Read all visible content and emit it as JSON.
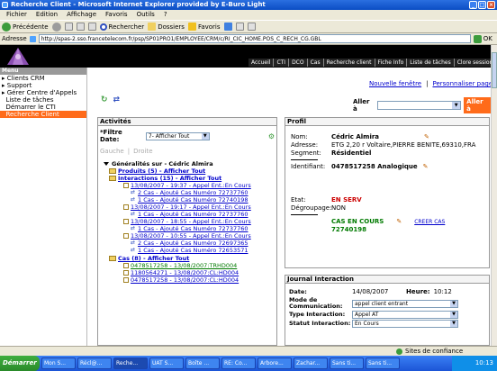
{
  "window": {
    "title": "Recherche Client - Microsoft Internet Explorer provided by E-Buro Light"
  },
  "menu": [
    "Fichier",
    "Edition",
    "Affichage",
    "Favoris",
    "Outils",
    "?"
  ],
  "toolbar": {
    "back": "Précédente",
    "search": "Rechercher",
    "folders": "Dossiers",
    "favorites": "Favoris"
  },
  "address": {
    "label": "Adresse",
    "url": "http://spas-2.sso.francetelecom.fr/psp/SP01PRO1/EMPLOYEE/CRM/c/RI_CIC_HOME.POS_C_RECH_CG.GBL",
    "go": "OK"
  },
  "nav": [
    "Accueil",
    "CTI",
    "DCO",
    "Cas",
    "Recherche client",
    "Fiche Info",
    "Liste de tâches",
    "Clore session"
  ],
  "sidebar": {
    "title": "Menu",
    "items": [
      "Clients CRM",
      "Support",
      "Gérer Centre d'Appels",
      "Liste de tâches",
      "Démarrer le CTI",
      "Recherche Client"
    ]
  },
  "main": {
    "links": [
      "Nouvelle fenêtre",
      "Personnaliser page"
    ],
    "goto_label": "Aller à",
    "goto_btn": "Aller à"
  },
  "activites": {
    "title": "Activités",
    "filter_label": "*Filtre Date:",
    "filter_value": "7- Afficher Tout",
    "nav_prev": "Gauche",
    "nav_next": "Droite",
    "root": "Généralités sur - Cédric Almira",
    "produits": "Produits (5) - Afficher Tout",
    "interactions": "Interactions (15) - Afficher Tout",
    "items": [
      {
        "type": "cal",
        "text": "13/08/2007 - 19:37 - Appel Ent.:En Cours"
      },
      {
        "type": "arr",
        "text": "2 Cas - Ajouté Cas Numéro 72737760"
      },
      {
        "type": "arr",
        "text": "1 Cas - Ajouté Cas Numéro 72740198"
      },
      {
        "type": "cal",
        "text": "13/08/2007 - 19:17 - Appel Ent.:En Cours"
      },
      {
        "type": "arr",
        "text": "1 Cas - Ajouté Cas Numéro 72737760"
      },
      {
        "type": "cal",
        "text": "13/08/2007 - 18:55 - Appel Ent.:En Cours"
      },
      {
        "type": "arr",
        "text": "1 Cas - Ajouté Cas Numéro 72737760"
      },
      {
        "type": "cal",
        "text": "13/08/2007 - 10:55 - Appel Ent.:En Cours"
      },
      {
        "type": "arr",
        "text": "2 Cas - Ajouté Cas Numéro 72697365"
      },
      {
        "type": "arr",
        "text": "1 Cas - Ajouté Cas Numéro 72653571"
      }
    ],
    "cas": "Cas (8) - Afficher Tout",
    "cas_items": [
      "0478517258 - 13/08/2007:TRHD004",
      "1180564271 - 13/08/2007:CL:HD004",
      "0478517258 - 13/08/2007:CL:HD004"
    ]
  },
  "profil": {
    "title": "Profil",
    "nom_k": "Nom:",
    "nom_v": "Cédric Almira",
    "adresse_k": "Adresse:",
    "adresse_v": "ETG 2,20 r Voltaire,PIERRE BENITE,69310,FRA",
    "segment_k": "Segment:",
    "segment_v": "Résidentiel",
    "ident_k": "Identifiant:",
    "ident_v": "0478517258 Analogique",
    "etat_k": "Etat:",
    "etat_v": "EN SERV",
    "degroup_k": "Dégroupage:",
    "degroup_v": "NON",
    "cas_v": "CAS EN COURS",
    "cas_num": "72740198",
    "creer": "CREER CAS"
  },
  "journal": {
    "title": "Journal Interaction",
    "date_k": "Date:",
    "date_v": "14/08/2007",
    "heure_k": "Heure:",
    "heure_v": "10:12",
    "mode_k": "Mode de Communication:",
    "mode_v": "appel client entrant",
    "type_k": "Type Interaction:",
    "type_v": "Appel AT",
    "statut_k": "Statut Interaction:",
    "statut_v": "En Cours"
  },
  "status": {
    "text": "Sites de confiance"
  },
  "taskbar": {
    "start": "Démarrer",
    "tasks": [
      "Mon S...",
      "Récl@...",
      "Reche...",
      "UAT S...",
      "Boîte ...",
      "RE: Co...",
      "Arbore...",
      "Zachar...",
      "Sans ti...",
      "Sans ti..."
    ],
    "time": "10:13"
  }
}
